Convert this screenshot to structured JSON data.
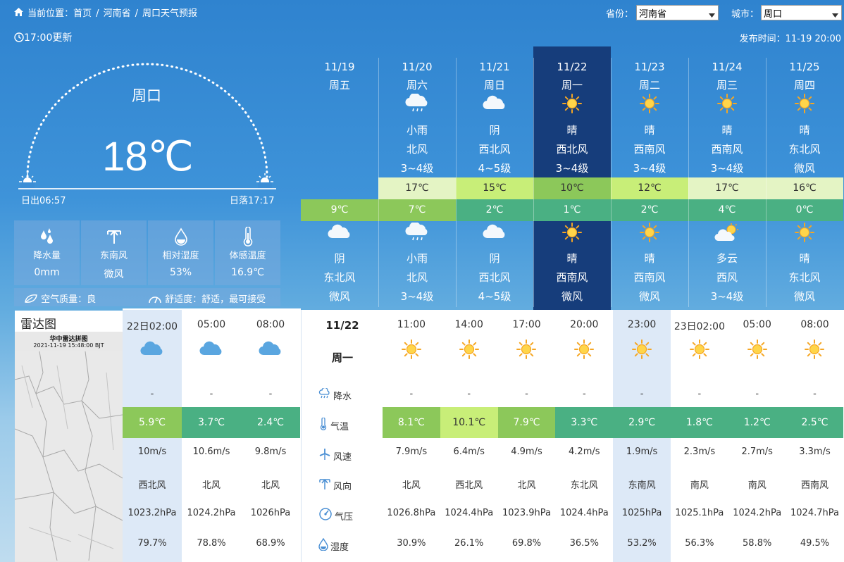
{
  "breadcrumb": {
    "prefix": "当前位置：",
    "items": [
      "首页",
      "/",
      "河南省",
      "/",
      "周口天气预报"
    ]
  },
  "selectors": {
    "province_label": "省份：",
    "province_value": "河南省",
    "city_label": "城市：",
    "city_value": "周口"
  },
  "update_time": "17:00更新",
  "publish_time": "发布时间：11-19 20:00",
  "current": {
    "city": "周口",
    "temp": "18℃",
    "sunrise": "日出06:57",
    "sunset": "日落17:17",
    "stats": [
      {
        "icon": "rain-drops-icon",
        "label": "降水量",
        "value": "0mm"
      },
      {
        "icon": "wind-direction-icon",
        "label": "东南风",
        "value": "微风"
      },
      {
        "icon": "humidity-drop-icon",
        "label": "相对湿度",
        "value": "53%"
      },
      {
        "icon": "thermometer-icon",
        "label": "体感温度",
        "value": "16.9℃"
      }
    ],
    "air_quality": "空气质量：良",
    "comfort": "舒适度：舒适，最可接受"
  },
  "radar": {
    "title": "雷达图",
    "map_title": "华中雷达拼图",
    "map_time": "2021-11-19 15:48:00 BJT"
  },
  "forecast": [
    {
      "date": "11/19",
      "week": "周五",
      "day_icon": "",
      "day_desc": "",
      "day_wind": "",
      "day_level": "",
      "high": "",
      "high_color": "",
      "low": "9℃",
      "low_color": "#8cc85a",
      "night_icon": "cloudy-icon",
      "night_desc": "阴",
      "night_wind": "东北风",
      "night_level": "微风"
    },
    {
      "date": "11/20",
      "week": "周六",
      "day_icon": "light-rain-icon",
      "day_desc": "小雨",
      "day_wind": "北风",
      "day_level": "3~4级",
      "high": "17℃",
      "high_color": "#e4f4c4",
      "low": "7℃",
      "low_color": "#8cc85a",
      "night_icon": "light-rain-icon",
      "night_desc": "小雨",
      "night_wind": "北风",
      "night_level": "3~4级"
    },
    {
      "date": "11/21",
      "week": "周日",
      "day_icon": "cloudy-icon",
      "day_desc": "阴",
      "day_wind": "西北风",
      "day_level": "4~5级",
      "high": "15℃",
      "high_color": "#c8ee78",
      "low": "2℃",
      "low_color": "#4ab083",
      "night_icon": "cloudy-icon",
      "night_desc": "阴",
      "night_wind": "西北风",
      "night_level": "4~5级"
    },
    {
      "date": "11/22",
      "week": "周一",
      "day_icon": "sunny-icon",
      "day_desc": "晴",
      "day_wind": "西北风",
      "day_level": "3~4级",
      "high": "10℃",
      "high_color": "#8cc85a",
      "low": "1℃",
      "low_color": "#4ab083",
      "night_icon": "sunny-icon",
      "night_desc": "晴",
      "night_wind": "西南风",
      "night_level": "微风"
    },
    {
      "date": "11/23",
      "week": "周二",
      "day_icon": "sunny-icon",
      "day_desc": "晴",
      "day_wind": "西南风",
      "day_level": "3~4级",
      "high": "12℃",
      "high_color": "#c8ee78",
      "low": "2℃",
      "low_color": "#4ab083",
      "night_icon": "sunny-icon",
      "night_desc": "晴",
      "night_wind": "西南风",
      "night_level": "微风"
    },
    {
      "date": "11/24",
      "week": "周三",
      "day_icon": "sunny-icon",
      "day_desc": "晴",
      "day_wind": "西南风",
      "day_level": "3~4级",
      "high": "17℃",
      "high_color": "#e4f4c4",
      "low": "4℃",
      "low_color": "#4ab083",
      "night_icon": "partly-cloudy-icon",
      "night_desc": "多云",
      "night_wind": "西风",
      "night_level": "3~4级"
    },
    {
      "date": "11/25",
      "week": "周四",
      "day_icon": "sunny-icon",
      "day_desc": "晴",
      "day_wind": "东北风",
      "day_level": "微风",
      "high": "16℃",
      "high_color": "#e4f4c4",
      "low": "0℃",
      "low_color": "#4ab083",
      "night_icon": "sunny-icon",
      "night_desc": "晴",
      "night_wind": "东北风",
      "night_level": "微风"
    }
  ],
  "hourly_header": {
    "date": "11/22",
    "week": "周一"
  },
  "row_labels": {
    "rain": "降水",
    "temp": "气温",
    "speed": "风速",
    "dir": "风向",
    "press": "气压",
    "hum": "湿度"
  },
  "hourly_prev": [
    {
      "time": "22日02:00",
      "icon": "cloudy-icon",
      "rain": "-",
      "temp": "5.9℃",
      "temp_color": "#8cc85a",
      "speed": "10m/s",
      "dir": "西北风",
      "press": "1023.2hPa",
      "hum": "79.7%"
    },
    {
      "time": "05:00",
      "icon": "cloudy-icon",
      "rain": "-",
      "temp": "3.7℃",
      "temp_color": "#4ab083",
      "speed": "10.6m/s",
      "dir": "北风",
      "press": "1024.2hPa",
      "hum": "78.8%"
    },
    {
      "time": "08:00",
      "icon": "cloudy-icon",
      "rain": "-",
      "temp": "2.4℃",
      "temp_color": "#4ab083",
      "speed": "9.8m/s",
      "dir": "北风",
      "press": "1026hPa",
      "hum": "68.9%"
    }
  ],
  "hourly": [
    {
      "time": "11:00",
      "icon": "sunny-icon",
      "rain": "-",
      "temp": "8.1℃",
      "temp_color": "#8cc85a",
      "speed": "7.9m/s",
      "dir": "北风",
      "press": "1026.8hPa",
      "hum": "30.9%"
    },
    {
      "time": "14:00",
      "icon": "sunny-icon",
      "rain": "-",
      "temp": "10.1℃",
      "temp_color": "#c8ee78",
      "speed": "6.4m/s",
      "dir": "西北风",
      "press": "1024.4hPa",
      "hum": "26.1%"
    },
    {
      "time": "17:00",
      "icon": "sunny-icon",
      "rain": "-",
      "temp": "7.9℃",
      "temp_color": "#8cc85a",
      "speed": "4.9m/s",
      "dir": "北风",
      "press": "1023.9hPa",
      "hum": "69.8%"
    },
    {
      "time": "20:00",
      "icon": "sunny-icon",
      "rain": "-",
      "temp": "3.3℃",
      "temp_color": "#4ab083",
      "speed": "4.2m/s",
      "dir": "东北风",
      "press": "1024.4hPa",
      "hum": "36.5%"
    },
    {
      "time": "23:00",
      "icon": "sunny-icon",
      "rain": "-",
      "temp": "2.9℃",
      "temp_color": "#4ab083",
      "speed": "1.9m/s",
      "dir": "东南风",
      "press": "1025hPa",
      "hum": "53.2%"
    },
    {
      "time": "23日02:00",
      "icon": "sunny-icon",
      "rain": "-",
      "temp": "1.8℃",
      "temp_color": "#4ab083",
      "speed": "2.3m/s",
      "dir": "南风",
      "press": "1025.1hPa",
      "hum": "56.3%"
    },
    {
      "time": "05:00",
      "icon": "sunny-icon",
      "rain": "-",
      "temp": "1.2℃",
      "temp_color": "#4ab083",
      "speed": "2.7m/s",
      "dir": "南风",
      "press": "1024.2hPa",
      "hum": "58.8%"
    },
    {
      "time": "08:00",
      "icon": "sunny-icon",
      "rain": "-",
      "temp": "2.5℃",
      "temp_color": "#4ab083",
      "speed": "3.3m/s",
      "dir": "西南风",
      "press": "1024.7hPa",
      "hum": "49.5%"
    }
  ]
}
